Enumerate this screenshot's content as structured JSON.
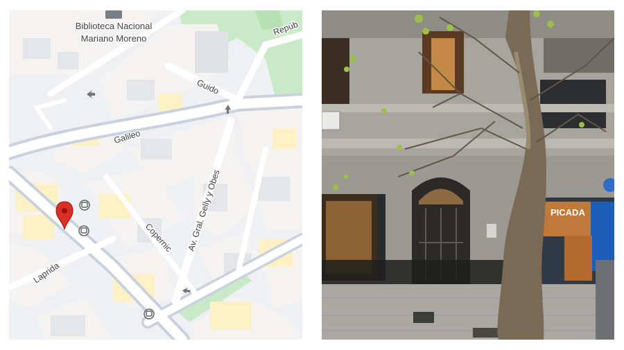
{
  "map": {
    "poi": {
      "line1": "Biblioteca Nacional",
      "line2": "Mariano Moreno",
      "icon": "library-icon"
    },
    "streets": {
      "republica": "Repúb",
      "guido": "Guido",
      "galileo": "Galileo",
      "gelly": "Av. Gral. Gelly y Obes",
      "copernico": "Copernic",
      "laprida": "Laprida"
    },
    "pin_icon": "location-pin-icon",
    "bus_icon": "bus-stop-icon",
    "colors": {
      "block": "#f4f3f1",
      "building": "#e8eaed",
      "building_highlight": "#fdf0c4",
      "road": "#ffffff",
      "road_major": "#c8d1dd",
      "park": "#c9eac7",
      "pin": "#d93025"
    }
  },
  "street_view": {
    "storefront_sign": "PICADA",
    "door_ornament": "arched-door",
    "colors": {
      "facade": "#a7a49d",
      "sidewalk": "#a9a8a3",
      "tree": "#7a6a55"
    }
  }
}
